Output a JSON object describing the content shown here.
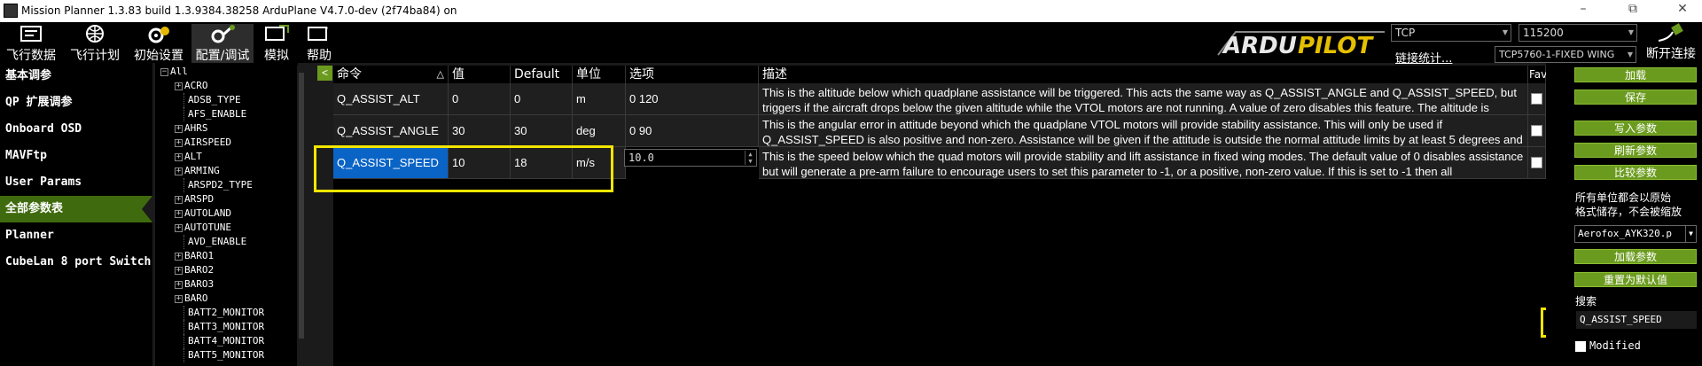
{
  "window": {
    "title": "Mission Planner 1.3.83 build 1.3.9384.38258 ArduPlane V4.7.0-dev (2f74ba84) on",
    "minimize": "–",
    "maximize": "⧉",
    "close": "✕"
  },
  "toolbar": {
    "items": [
      {
        "label": "飞行数据",
        "icon": "flight-data-icon"
      },
      {
        "label": "飞行计划",
        "icon": "flight-plan-icon"
      },
      {
        "label": "初始设置",
        "icon": "initial-setup-icon"
      },
      {
        "label": "配置/调试",
        "icon": "config-tuning-icon"
      },
      {
        "label": "模拟",
        "icon": "simulation-icon"
      },
      {
        "label": "帮助",
        "icon": "help-icon"
      }
    ],
    "logo_text_ardu": "ARDU",
    "logo_text_pilot": "PILOT",
    "connection_type": "TCP",
    "baud_rate": "115200",
    "stats_link": "链接统计...",
    "port": "TCP5760-1-FIXED WING",
    "disconnect": "断开连接",
    "active_color": "#2d2d2d"
  },
  "sidebar": {
    "items": [
      {
        "label": "基本调参"
      },
      {
        "label": "QP 扩展调参"
      },
      {
        "label": "Onboard OSD"
      },
      {
        "label": "MAVFtp"
      },
      {
        "label": "User Params"
      },
      {
        "label": "全部参数表"
      },
      {
        "label": "Planner"
      },
      {
        "label": "CubeLan 8 port Switch"
      }
    ],
    "active_index": 5,
    "active_color": "#3f6a0d"
  },
  "tree": {
    "nodes": [
      {
        "label": "All",
        "expander": "−"
      },
      {
        "label": "ACRO",
        "expander": "+"
      },
      {
        "label": "ADSB_TYPE",
        "expander": ""
      },
      {
        "label": "AFS_ENABLE",
        "expander": ""
      },
      {
        "label": "AHRS",
        "expander": "+"
      },
      {
        "label": "AIRSPEED",
        "expander": "+"
      },
      {
        "label": "ALT",
        "expander": "+"
      },
      {
        "label": "ARMING",
        "expander": "+"
      },
      {
        "label": "ARSPD2_TYPE",
        "expander": ""
      },
      {
        "label": "ARSPD",
        "expander": "+"
      },
      {
        "label": "AUTOLAND",
        "expander": "+"
      },
      {
        "label": "AUTOTUNE",
        "expander": "+"
      },
      {
        "label": "AVD_ENABLE",
        "expander": ""
      },
      {
        "label": "BARO1",
        "expander": "+"
      },
      {
        "label": "BARO2",
        "expander": "+"
      },
      {
        "label": "BARO3",
        "expander": "+"
      },
      {
        "label": "BARO",
        "expander": "+"
      },
      {
        "label": "BATT2_MONITOR",
        "expander": ""
      },
      {
        "label": "BATT3_MONITOR",
        "expander": ""
      },
      {
        "label": "BATT4_MONITOR",
        "expander": ""
      },
      {
        "label": "BATT5_MONITOR",
        "expander": ""
      }
    ]
  },
  "grid": {
    "collapse_glyph": "<",
    "sort_glyph": "△",
    "columns": {
      "command": "命令",
      "value": "值",
      "default": "Default",
      "units": "单位",
      "options": "选项",
      "description": "描述",
      "fav": "Fav"
    },
    "rows": [
      {
        "command": "Q_ASSIST_ALT",
        "value": "0",
        "default": "0",
        "units": "m",
        "options": "0 120",
        "description": "This is the altitude below which quadplane assistance will be triggered. This acts the same way as Q_ASSIST_ANGLE and Q_ASSIST_SPEED, but triggers if the aircraft drops below the given altitude while the VTOL motors are not running. A value of zero disables this feature. The altitude is"
      },
      {
        "command": "Q_ASSIST_ANGLE",
        "value": "30",
        "default": "30",
        "units": "deg",
        "options": "0 90",
        "description": "This is the angular error in attitude beyond which the quadplane VTOL motors will provide stability assistance. This will only be used if Q_ASSIST_SPEED is also positive and non-zero. Assistance will be given if the attitude is outside the normal attitude limits by at least 5 degrees and"
      },
      {
        "command": "Q_ASSIST_SPEED",
        "value": "10",
        "default": "18",
        "units": "m/s",
        "options": "",
        "description": "This is the speed below which the quad motors will provide stability and lift assistance in fixed wing modes. The default value of 0 disables assistance but will generate a pre-arm failure to encourage users to set this parameter to -1, or a positive, non-zero value. If this is set to -1 then all"
      }
    ],
    "edit_value": "10.0",
    "selected_color": "#0a64c6"
  },
  "right_panel": {
    "buttons": {
      "load": "加载",
      "save": "保存",
      "write": "写入参数",
      "refresh": "刷新参数",
      "compare": "比较参数",
      "load_presaved": "加载参数",
      "reset_default": "重置为默认值"
    },
    "note_line1": "所有单位都会以原始",
    "note_line2": "格式储存，不会被缩放",
    "param_file": "Aerofox_AYK320.p",
    "search_label": "搜索",
    "search_value": "Q_ASSIST_SPEED",
    "modified_label": "Modified",
    "button_color": "#6b9b1e"
  },
  "highlight_color": "#f2e600"
}
